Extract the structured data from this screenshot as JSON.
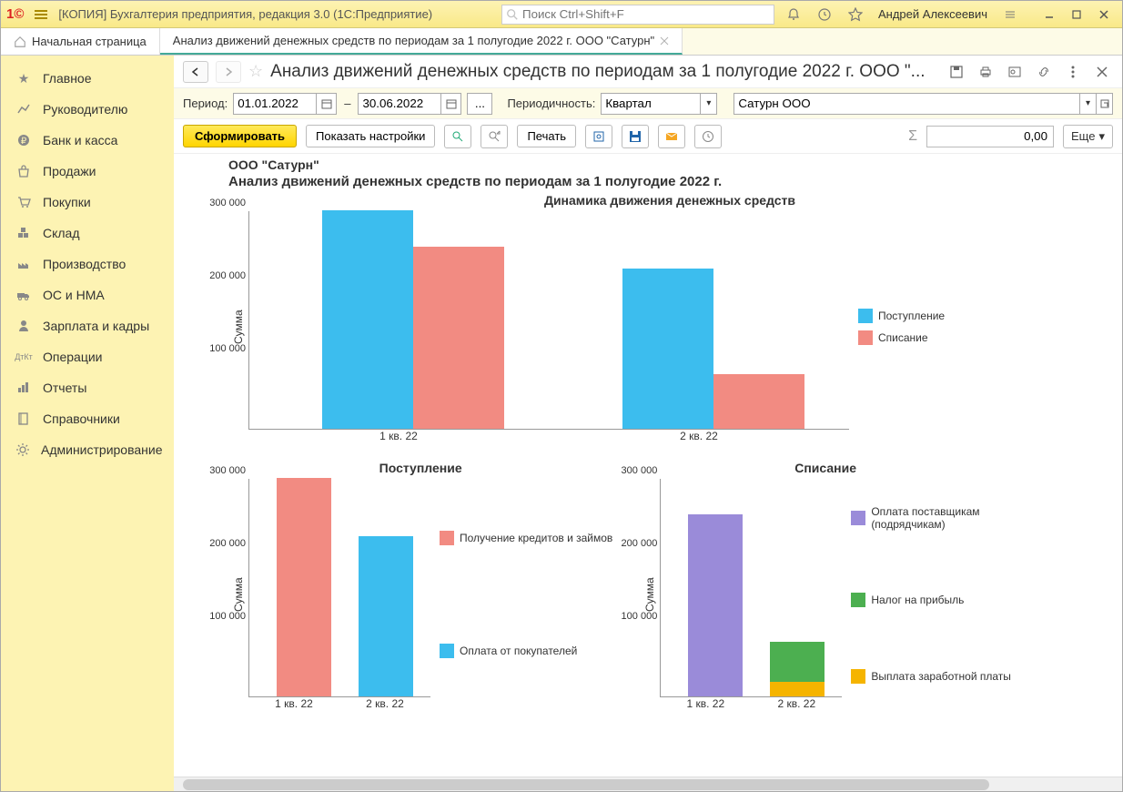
{
  "titlebar": {
    "title": "[КОПИЯ] Бухгалтерия предприятия, редакция 3.0  (1С:Предприятие)",
    "search_placeholder": "Поиск Ctrl+Shift+F",
    "user": "Андрей Алексеевич"
  },
  "tabs": {
    "home": "Начальная страница",
    "active": "Анализ движений денежных средств по периодам за 1 полугодие 2022 г. ООО \"Сатурн\""
  },
  "sidebar": {
    "items": [
      "Главное",
      "Руководителю",
      "Банк и касса",
      "Продажи",
      "Покупки",
      "Склад",
      "Производство",
      "ОС и НМА",
      "Зарплата и кадры",
      "Операции",
      "Отчеты",
      "Справочники",
      "Администрирование"
    ]
  },
  "toolbar1": {
    "title": "Анализ движений денежных средств по периодам за 1 полугодие 2022 г. ООО \"..."
  },
  "toolbar2": {
    "period_label": "Период:",
    "date_from": "01.01.2022",
    "date_to": "30.06.2022",
    "dash": "–",
    "dots": "...",
    "periodicity_label": "Периодичность:",
    "periodicity_value": "Квартал",
    "org_value": "Сатурн ООО"
  },
  "toolbar3": {
    "generate": "Сформировать",
    "show_settings": "Показать настройки",
    "print": "Печать",
    "sigma": "Σ",
    "sum_value": "0,00",
    "more": "Еще"
  },
  "report": {
    "company": "ООО \"Сатурн\"",
    "subtitle": "Анализ движений денежных средств по периодам за 1 полугодие 2022 г."
  },
  "chart_data": [
    {
      "id": "main",
      "type": "bar",
      "title": "Динамика движения денежных средств",
      "ylabel": "Сумма",
      "categories": [
        "1 кв. 22",
        "2 кв. 22"
      ],
      "series": [
        {
          "name": "Поступление",
          "color": "c-blue",
          "values": [
            300000,
            220000
          ]
        },
        {
          "name": "Списание",
          "color": "c-red",
          "values": [
            250000,
            75000
          ]
        }
      ],
      "ylim": [
        0,
        300000
      ],
      "ticks": [
        100000,
        200000,
        300000
      ],
      "tick_labels": [
        "100 000",
        "200 000",
        "300 000"
      ]
    },
    {
      "id": "income",
      "type": "bar",
      "title": "Поступление",
      "ylabel": "Сумма",
      "categories": [
        "1 кв. 22",
        "2 кв. 22"
      ],
      "series": [
        {
          "name": "Получение кредитов и займов",
          "color": "c-red",
          "values": [
            300000,
            0
          ]
        },
        {
          "name": "Оплата от покупателей",
          "color": "c-blue",
          "values": [
            0,
            220000
          ]
        }
      ],
      "ylim": [
        0,
        300000
      ],
      "ticks": [
        100000,
        200000,
        300000
      ],
      "tick_labels": [
        "100 000",
        "200 000",
        "300 000"
      ]
    },
    {
      "id": "expense",
      "type": "stacked-bar",
      "title": "Списание",
      "ylabel": "Сумма",
      "categories": [
        "1 кв. 22",
        "2 кв. 22"
      ],
      "series": [
        {
          "name": "Оплата поставщикам (подрядчикам)",
          "color": "c-purple",
          "values": [
            250000,
            0
          ]
        },
        {
          "name": "Налог на прибыль",
          "color": "c-green",
          "values": [
            0,
            55000
          ]
        },
        {
          "name": "Выплата заработной платы",
          "color": "c-yellow",
          "values": [
            0,
            20000
          ]
        }
      ],
      "ylim": [
        0,
        300000
      ],
      "ticks": [
        100000,
        200000,
        300000
      ],
      "tick_labels": [
        "100 000",
        "200 000",
        "300 000"
      ]
    }
  ]
}
